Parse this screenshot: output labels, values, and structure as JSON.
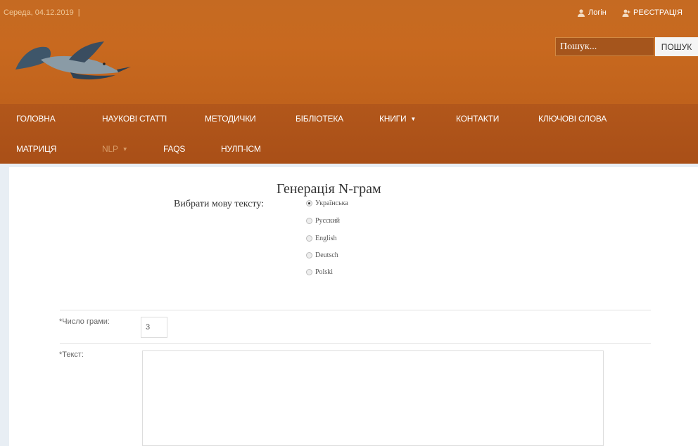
{
  "header": {
    "date": "Середа, 04.12.2019",
    "date_sep": "|",
    "login_label": "Логін",
    "register_label": "РЕЄСТРАЦІЯ",
    "search_placeholder": "Пошук...",
    "search_button": "ПОШУК"
  },
  "nav": {
    "row1": [
      "ГОЛОВНА",
      "НАУКОВІ СТАТТІ",
      "МЕТОДИЧКИ",
      "БІБЛІОТЕКА",
      "КНИГИ",
      "КОНТАКТИ",
      "КЛЮЧОВІ СЛОВА"
    ],
    "row2": [
      "МАТРИЦЯ",
      "NLP",
      "FAQS",
      "НУЛП-ІСМ"
    ]
  },
  "main": {
    "title": "Генерація N-грам",
    "language_label": "Вибрати мову тексту:",
    "languages": [
      "Українська",
      "Русский",
      "English",
      "Deutsch",
      "Polski"
    ],
    "selected_language": "Українська",
    "n_gram_label": "*Число грами:",
    "n_gram_value": "3",
    "text_label": "*Текст:"
  },
  "colors": {
    "header": "#c56a22",
    "nav": "#ad5318",
    "accent": "#d28a44"
  }
}
